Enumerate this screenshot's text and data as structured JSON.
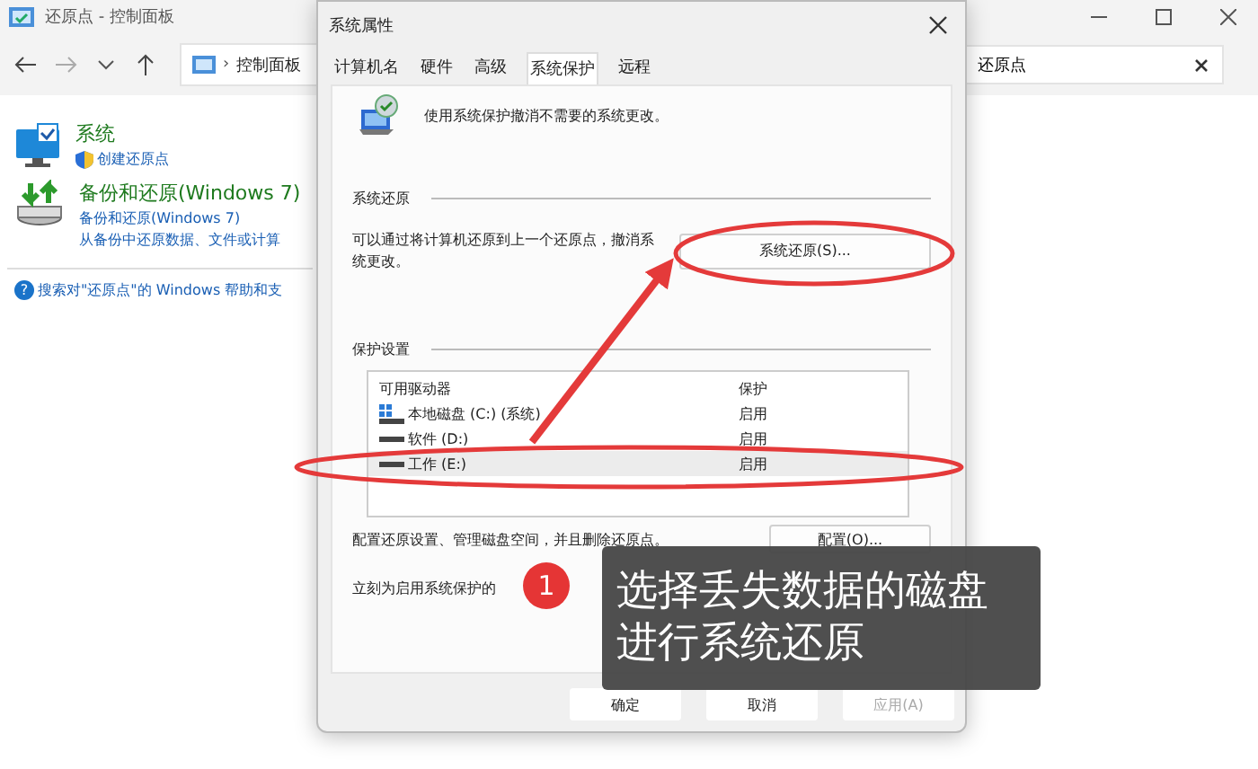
{
  "window": {
    "title": "还原点 - 控制面板",
    "address_separator": "›",
    "address": "控制面板",
    "search": {
      "value": "还原点"
    }
  },
  "results": [
    {
      "kind": "system",
      "title": "系统",
      "links": [
        "创建还原点"
      ],
      "shield": true
    },
    {
      "kind": "backup",
      "title": "备份和还原(Windows 7)",
      "links": [
        "备份和还原(Windows 7)",
        "从备份中还原数据、文件或计算"
      ],
      "shield": false
    }
  ],
  "help": {
    "icon": "?",
    "link": "搜索对\"还原点\"的 Windows 帮助和支"
  },
  "dialog": {
    "title": "系统属性",
    "tabs": [
      {
        "label": "计算机名",
        "selected": false
      },
      {
        "label": "硬件",
        "selected": false
      },
      {
        "label": "高级",
        "selected": false
      },
      {
        "label": "系统保护",
        "selected": true
      },
      {
        "label": "远程",
        "selected": false
      }
    ],
    "intro": "使用系统保护撤消不需要的系统更改。",
    "restore_group": {
      "title": "系统还原",
      "text_lines": [
        "可以通过将计算机还原到上一个还原点，撤消系",
        "统更改。"
      ],
      "button": "系统还原(S)..."
    },
    "protection_group": {
      "title": "保护设置",
      "columns": [
        "可用驱动器",
        "保护"
      ],
      "rows": [
        {
          "kind": "system",
          "drive": "本地磁盘 (C:) (系统)",
          "protection": "启用",
          "selected": false
        },
        {
          "kind": "plain",
          "drive": "软件 (D:)",
          "protection": "启用",
          "selected": false
        },
        {
          "kind": "plain",
          "drive": "工作 (E:)",
          "protection": "启用",
          "selected": true
        }
      ],
      "configure_text": "配置还原设置、管理磁盘空间，并且删除还原点。",
      "configure_button": "配置(O)...",
      "create_text": "立刻为启用系统保护的"
    },
    "buttons": [
      {
        "label": "确定",
        "disabled": false
      },
      {
        "label": "取消",
        "disabled": false
      },
      {
        "label": "应用(A)",
        "disabled": true
      }
    ]
  },
  "annotation": {
    "badge": "1",
    "callout_lines": [
      "选择丢失数据的磁盘",
      "进行系统还原"
    ]
  }
}
